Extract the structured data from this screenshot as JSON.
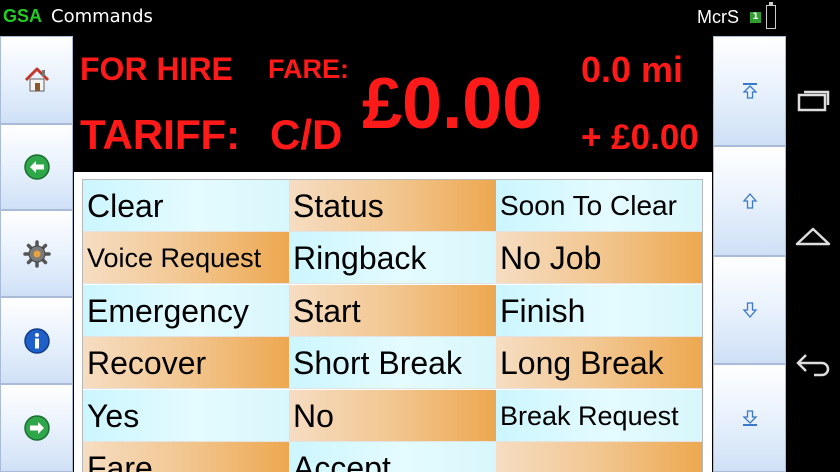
{
  "titlebar": {
    "app_logo": "GSA",
    "title": "Commands",
    "user": "McrS",
    "badge": "1"
  },
  "meter": {
    "status": "FOR HIRE",
    "fare_label": "FARE:",
    "fare_value": "£0.00",
    "tariff_label": "TARIFF:",
    "tariff_value": "C/D",
    "distance": "0.0 mi",
    "extras": "+ £0.00",
    "text_color": "#ff1a1a"
  },
  "left_toolbar": [
    {
      "icon": "home-icon"
    },
    {
      "icon": "back-arrow-icon"
    },
    {
      "icon": "settings-gear-icon"
    },
    {
      "icon": "info-icon"
    },
    {
      "icon": "forward-arrow-icon"
    }
  ],
  "right_toolbar": [
    {
      "icon": "scroll-top-icon"
    },
    {
      "icon": "scroll-up-icon"
    },
    {
      "icon": "scroll-down-icon"
    },
    {
      "icon": "scroll-bottom-icon"
    }
  ],
  "commands": {
    "rows": [
      [
        {
          "label": "Clear",
          "style": "cyan"
        },
        {
          "label": "Status",
          "style": "orange"
        },
        {
          "label": "Soon To Clear",
          "style": "cyan"
        }
      ],
      [
        {
          "label": "Voice Request",
          "style": "orange"
        },
        {
          "label": "Ringback",
          "style": "cyan"
        },
        {
          "label": "No Job",
          "style": "orange"
        }
      ],
      [
        {
          "label": "Emergency",
          "style": "cyan"
        },
        {
          "label": "Start",
          "style": "orange"
        },
        {
          "label": "Finish",
          "style": "cyan"
        }
      ],
      [
        {
          "label": "Recover",
          "style": "orange"
        },
        {
          "label": "Short Break",
          "style": "cyan"
        },
        {
          "label": "Long Break",
          "style": "orange"
        }
      ],
      [
        {
          "label": "Yes",
          "style": "cyan"
        },
        {
          "label": "No",
          "style": "orange"
        },
        {
          "label": "Break Request",
          "style": "cyan"
        }
      ],
      [
        {
          "label": "Fare",
          "style": "orange"
        },
        {
          "label": "Accept",
          "style": "cyan"
        },
        {
          "label": "",
          "style": "orange"
        }
      ]
    ]
  },
  "colors": {
    "accent_green": "#22cc22",
    "cell_cyan": "#d4f8ff",
    "cell_orange": "#f0b870",
    "button_border": "#a9bbd6"
  }
}
